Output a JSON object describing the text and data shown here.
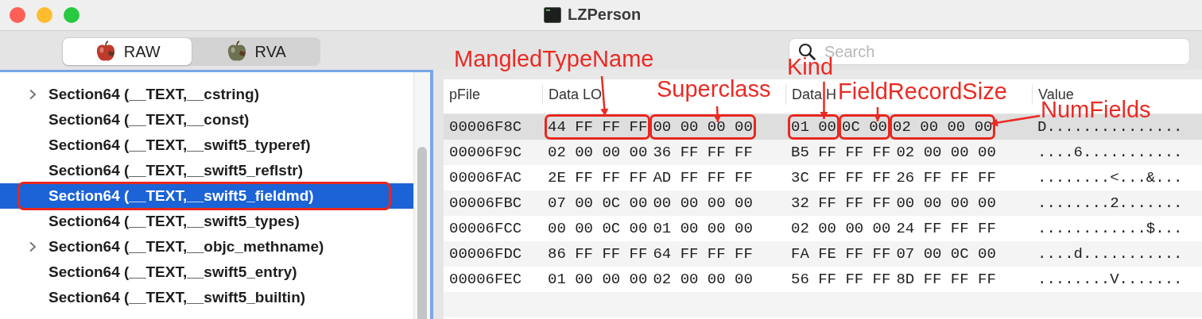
{
  "window": {
    "title": "LZPerson"
  },
  "toolbar": {
    "modes": [
      {
        "label": "RAW",
        "selected": true
      },
      {
        "label": "RVA",
        "selected": false
      }
    ],
    "search": {
      "placeholder": "Search"
    }
  },
  "sidebar": {
    "items": [
      {
        "label": "Section64 (__TEXT,__cstring)",
        "kind": "group",
        "expanded": false,
        "selected": false,
        "annotated": false
      },
      {
        "label": "Section64 (__TEXT,__const)",
        "kind": "leaf",
        "selected": false,
        "annotated": false
      },
      {
        "label": "Section64 (__TEXT,__swift5_typeref)",
        "kind": "leaf",
        "selected": false,
        "annotated": false
      },
      {
        "label": "Section64 (__TEXT,__swift5_reflstr)",
        "kind": "leaf",
        "selected": false,
        "annotated": false
      },
      {
        "label": "Section64 (__TEXT,__swift5_fieldmd)",
        "kind": "leaf",
        "selected": true,
        "annotated": true
      },
      {
        "label": "Section64 (__TEXT,__swift5_types)",
        "kind": "leaf",
        "selected": false,
        "annotated": false
      },
      {
        "label": "Section64 (__TEXT,__objc_methname)",
        "kind": "group",
        "expanded": false,
        "selected": false,
        "annotated": false
      },
      {
        "label": "Section64 (__TEXT,__swift5_entry)",
        "kind": "leaf",
        "selected": false,
        "annotated": false
      },
      {
        "label": "Section64 (__TEXT,__swift5_builtin)",
        "kind": "leaf",
        "selected": false,
        "annotated": false
      }
    ]
  },
  "table": {
    "columns": [
      "pFile",
      "Data LO",
      "Data H",
      "Value"
    ],
    "rows": [
      {
        "pfile": "00006F8C",
        "selected": true,
        "data_lo": [
          {
            "text": "44 FF FF FF",
            "boxed": true
          },
          {
            "text": "00 00 00 00",
            "boxed": true
          }
        ],
        "data_hi": [
          {
            "text": "01 00",
            "boxed": true
          },
          {
            "text": "0C 00",
            "boxed": true
          },
          {
            "text": "02 00 00 00",
            "boxed": true
          }
        ],
        "value": "D..............."
      },
      {
        "pfile": "00006F9C",
        "selected": false,
        "data_lo": [
          {
            "text": "02 00 00 00",
            "boxed": false
          },
          {
            "text": "36 FF FF FF",
            "boxed": false
          }
        ],
        "data_hi": [
          {
            "text": "B5 FF FF FF",
            "boxed": false
          },
          {
            "text": "02 00 00 00",
            "boxed": false
          }
        ],
        "value": "....6..........."
      },
      {
        "pfile": "00006FAC",
        "selected": false,
        "data_lo": [
          {
            "text": "2E FF FF FF",
            "boxed": false
          },
          {
            "text": "AD FF FF FF",
            "boxed": false
          }
        ],
        "data_hi": [
          {
            "text": "3C FF FF FF",
            "boxed": false
          },
          {
            "text": "26 FF FF FF",
            "boxed": false
          }
        ],
        "value": "........<...&..."
      },
      {
        "pfile": "00006FBC",
        "selected": false,
        "data_lo": [
          {
            "text": "07 00 0C 00",
            "boxed": false
          },
          {
            "text": "00 00 00 00",
            "boxed": false
          }
        ],
        "data_hi": [
          {
            "text": "32 FF FF FF",
            "boxed": false
          },
          {
            "text": "00 00 00 00",
            "boxed": false
          }
        ],
        "value": "........2......."
      },
      {
        "pfile": "00006FCC",
        "selected": false,
        "data_lo": [
          {
            "text": "00 00 0C 00",
            "boxed": false
          },
          {
            "text": "01 00 00 00",
            "boxed": false
          }
        ],
        "data_hi": [
          {
            "text": "02 00 00 00",
            "boxed": false
          },
          {
            "text": "24 FF FF FF",
            "boxed": false
          }
        ],
        "value": "............$..."
      },
      {
        "pfile": "00006FDC",
        "selected": false,
        "data_lo": [
          {
            "text": "86 FF FF FF",
            "boxed": false
          },
          {
            "text": "64 FF FF FF",
            "boxed": false
          }
        ],
        "data_hi": [
          {
            "text": "FA FE FF FF",
            "boxed": false
          },
          {
            "text": "07 00 0C 00",
            "boxed": false
          }
        ],
        "value": "....d..........."
      },
      {
        "pfile": "00006FEC",
        "selected": false,
        "data_lo": [
          {
            "text": "01 00 00 00",
            "boxed": false
          },
          {
            "text": "02 00 00 00",
            "boxed": false
          }
        ],
        "data_hi": [
          {
            "text": "56 FF FF FF",
            "boxed": false
          },
          {
            "text": "8D FF FF FF",
            "boxed": false
          }
        ],
        "value": "........V......."
      }
    ]
  },
  "annotations": [
    {
      "label": "MangledTypeName"
    },
    {
      "label": "Superclass"
    },
    {
      "label": "Kind"
    },
    {
      "label": "FieldRecordSize"
    },
    {
      "label": "NumFields"
    }
  ]
}
